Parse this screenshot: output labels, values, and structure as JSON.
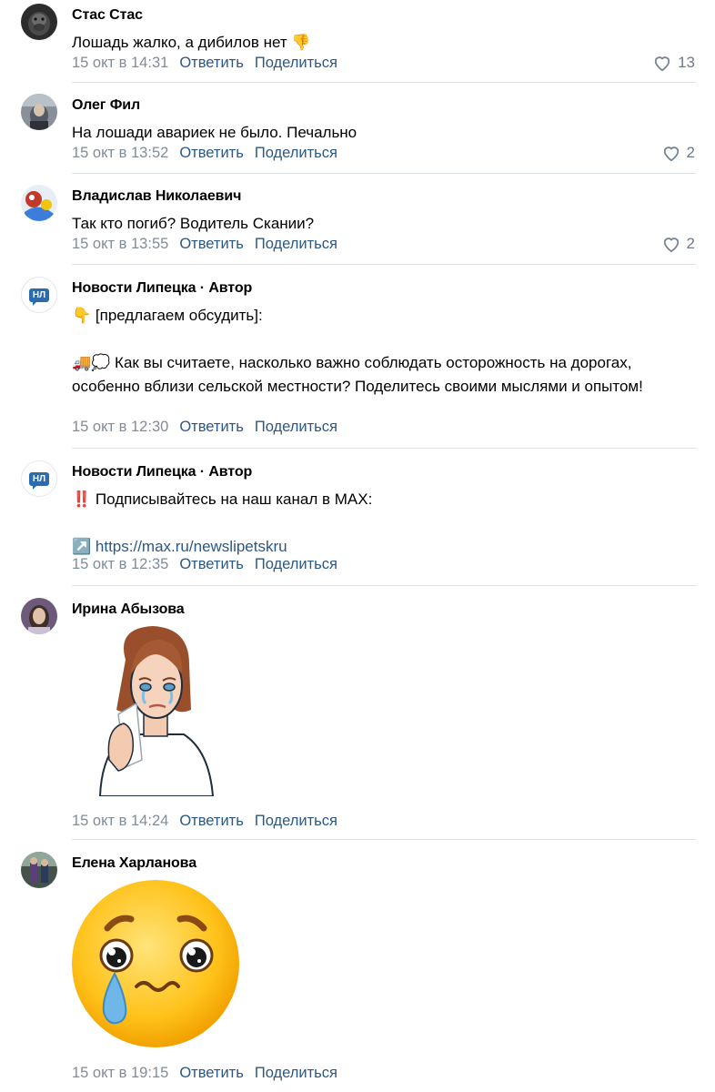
{
  "comments": [
    {
      "author": "Стас Стас",
      "text": "Лошадь жалко, а дибилов нет 👎",
      "time": "15 окт в 14:31",
      "reply": "Ответить",
      "share": "Поделиться",
      "likes": "13"
    },
    {
      "author": "Олег Фил",
      "text": "На лошади авариек не было. Печально",
      "time": "15 окт в 13:52",
      "reply": "Ответить",
      "share": "Поделиться",
      "likes": "2"
    },
    {
      "author": "Владислав Николаевич",
      "text": "Так кто погиб? Водитель Скании?",
      "time": "15 окт в 13:55",
      "reply": "Ответить",
      "share": "Поделиться",
      "likes": "2"
    },
    {
      "author": "Новости Липецка · Автор",
      "avatar_text": "НЛ",
      "line1": "👇 [предлагаем обсудить]:",
      "line2": "🚚💭 Как вы считаете, насколько важно соблюдать осторожность на дорогах, особенно вблизи сельской местности? Поделитесь своими мыслями и опытом!",
      "time": "15 окт в 12:30",
      "reply": "Ответить",
      "share": "Поделиться"
    },
    {
      "author": "Новости Липецка · Автор",
      "avatar_text": "НЛ",
      "line1": "‼️ Подписывайтесь на наш канал в MAX:",
      "link_icon": "↗️",
      "link": "https://max.ru/newslipetskru",
      "time": "15 окт в 12:35",
      "reply": "Ответить",
      "share": "Поделиться"
    },
    {
      "author": "Ирина Абызова",
      "sticker": "crying-woman-sticker",
      "time": "15 окт в 14:24",
      "reply": "Ответить",
      "share": "Поделиться"
    },
    {
      "author": "Елена Харланова",
      "sticker": "crying-emoji-sticker",
      "time": "15 окт в 19:15",
      "reply": "Ответить",
      "share": "Поделиться"
    }
  ],
  "colors": {
    "link": "#2a5885",
    "meta": "#818c99",
    "divider": "#dce1e6",
    "badge": "#2b6cb0"
  }
}
